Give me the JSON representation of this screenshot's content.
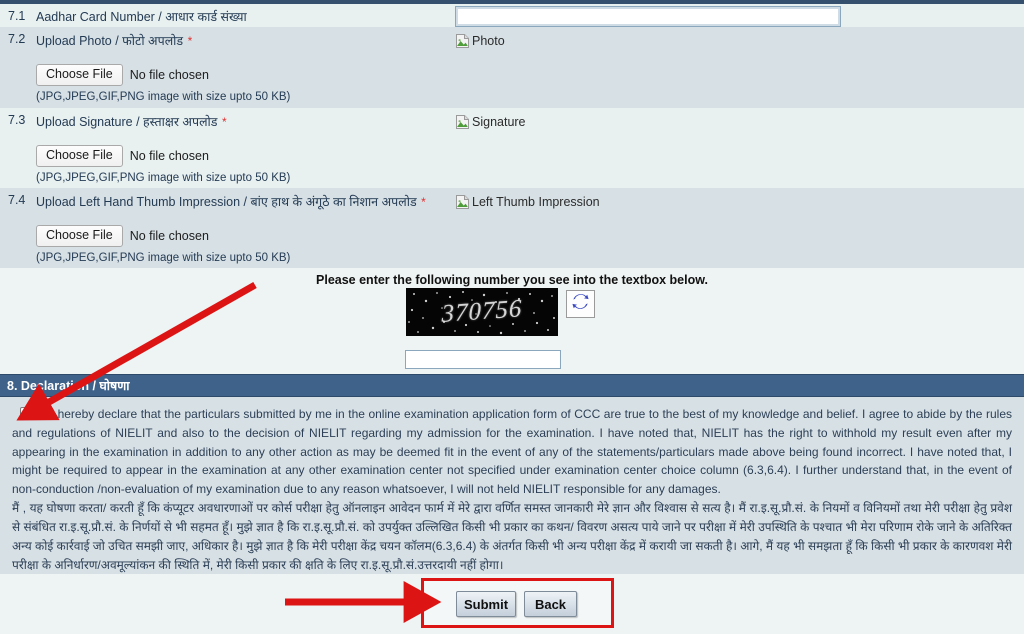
{
  "form": {
    "rows": [
      {
        "num": "7.1",
        "label": "Aadhar Card Number / आधार कार्ड संख्या",
        "required": false,
        "type": "text",
        "input_value": "",
        "image_alt": ""
      },
      {
        "num": "7.2",
        "label": "Upload Photo / फोटो अपलोड",
        "required": true,
        "type": "file",
        "choose_file_label": "Choose File",
        "no_file_text": "No file chosen",
        "hint": "(JPG,JPEG,GIF,PNG image with size upto 50 KB)",
        "image_alt": "Photo"
      },
      {
        "num": "7.3",
        "label": "Upload Signature / हस्ताक्षर अपलोड",
        "required": true,
        "type": "file",
        "choose_file_label": "Choose File",
        "no_file_text": "No file chosen",
        "hint": "(JPG,JPEG,GIF,PNG image with size upto 50 KB)",
        "image_alt": "Signature"
      },
      {
        "num": "7.4",
        "label": "Upload Left Hand Thumb Impression / बांए हाथ के अंगूठे का निशान अपलोड",
        "required": true,
        "type": "file",
        "choose_file_label": "Choose File",
        "no_file_text": "No file chosen",
        "hint": "(JPG,JPEG,GIF,PNG image with size upto 50 KB)",
        "image_alt": "Left Thumb Impression"
      }
    ]
  },
  "captcha": {
    "instruction": "Please enter the following number you see into the textbox below.",
    "code": "370756",
    "refresh_icon": "refresh-icon",
    "input_value": "",
    "input_placeholder": ""
  },
  "declaration": {
    "section_title": "8. Declaration / घोषणा",
    "required_star": "*",
    "checkbox_checked": false,
    "text_en": "I , hereby declare that the particulars submitted by me in the online examination application form of CCC are true to the best of my knowledge and belief. I agree to abide by the rules and regulations of NIELIT and also to the decision of NIELIT regarding my admission for the examination. I have noted that, NIELIT has the right to withhold my result even after my appearing in the examination in addition to any other action as may be deemed fit in the event of any of the statements/particulars made above being found incorrect. I have noted that, I might be required to appear in the examination at any other examination center not specified under examination center choice column (6.3,6.4). I further understand that, in the event of non-conduction /non-evaluation of my examination due to any reason whatsoever, I will not held NIELIT responsible for any damages.",
    "text_hi": "मैं , यह घोषणा करता/ करती  हूँ कि कंप्यूटर अवधारणाओं पर कोर्स परीक्षा हेतु ऑनलाइन आवेदन फार्म में मेरे द्वारा वर्णित समस्त जानकारी मेरे ज्ञान और विश्वास से सत्य है। मैं रा.इ.सू.प्रौ.सं. के नियमों व विनियमों तथा मेरी परीक्षा हेतु प्रवेश से संबंधित रा.इ.सू.प्रौ.सं. के निर्णयों से भी सहमत हूँ। मुझे ज्ञात है कि रा.इ.सू.प्रौ.सं. को उपर्युक्त उल्लिखित किसी भी प्रकार का कथन/ विवरण असत्य पाये जाने पर परीक्षा में मेरी उपस्थिति के पश्चात भी मेरा परिणाम रोके जाने के अतिरिक्त अन्य कोई कार्रवाई जो उचित समझी जाए, अधिकार है। मुझे ज्ञात है कि मेरी परीक्षा केंद्र चयन कॉलम(6.3,6.4) के अंतर्गत किसी भी अन्य परीक्षा केंद्र में करायी जा सकती है। आगे, मैं यह भी समझता हूँ कि किसी भी प्रकार के कारणवश मेरी परीक्षा के अनिर्धारण/अवमूल्यांकन की स्थिति में, मेरी किसी प्रकार की क्षति के लिए रा.इ.सू.प्रौ.सं.उत्तरदायी नहीं होगा।"
  },
  "actions": {
    "submit_label": "Submit",
    "back_label": "Back"
  },
  "colors": {
    "section_header_bg": "#3f628b",
    "row_alt_bg": "#d7e0e5",
    "row_plain_bg": "#e8f0f0",
    "annotation_red": "#dd1414",
    "required_red": "#e03030",
    "text_navy": "#2d4057"
  },
  "annotations": {
    "arrow_to_checkbox": "red-arrow-pointing-to-declaration-checkbox",
    "arrow_to_buttons": "red-arrow-pointing-to-submit-button",
    "highlight_box": "red-box-around-submit-and-back-buttons"
  }
}
